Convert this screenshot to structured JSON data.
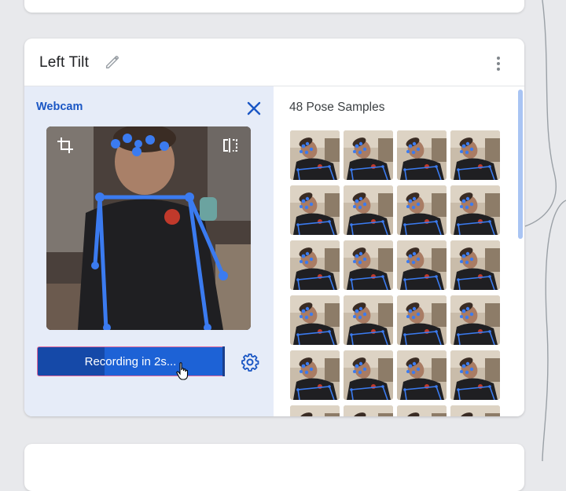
{
  "card": {
    "title": "Left Tilt",
    "webcam": {
      "label": "Webcam",
      "record_button_label": "Recording in 2s...",
      "record_progress": 0.36
    },
    "samples": {
      "title": "48 Pose Samples",
      "count": 48,
      "visible_rows": 6,
      "columns": 4
    }
  },
  "colors": {
    "accent": "#1a56c4",
    "button": "#1d62d6",
    "button_border": "#e2679a",
    "pose_line": "#3b7bf0",
    "panel_bg": "#e6ecf8"
  },
  "icons": {
    "edit": "pencil-icon",
    "more": "more-vert-icon",
    "close": "close-icon",
    "crop": "crop-icon",
    "flip": "flip-icon",
    "settings": "gear-icon",
    "cursor": "hand-pointer-icon"
  }
}
